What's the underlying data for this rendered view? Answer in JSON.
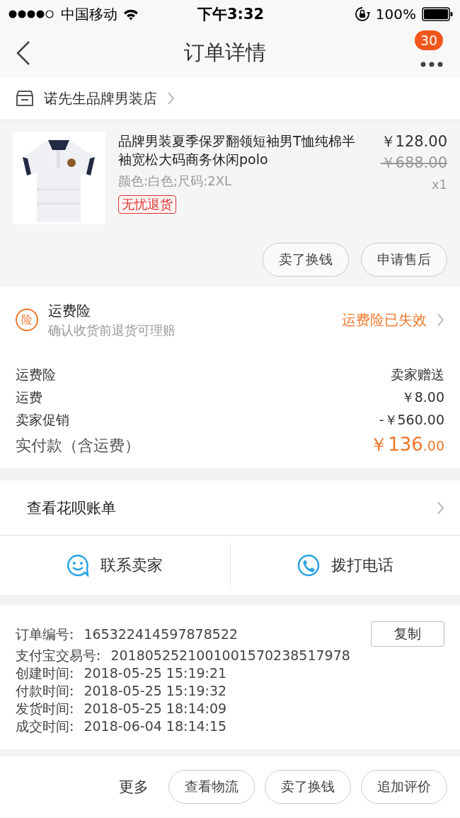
{
  "status_bar": {
    "carrier": "中国移动",
    "time": "下午3:32",
    "battery": "100%"
  },
  "nav": {
    "title": "订单详情",
    "badge": "30"
  },
  "store": {
    "name": "诺先生品牌男装店"
  },
  "product": {
    "title": "品牌男装夏季保罗翻领短袖男T恤纯棉半袖宽松大码商务休闲polo",
    "price": "￥128.00",
    "original_price": "￥688.00",
    "spec": "颜色:白色;尺码:2XL",
    "quantity": "x1",
    "tag": "无忧退货",
    "buttons": [
      "卖了换钱",
      "申请售后"
    ]
  },
  "insurance": {
    "icon_char": "险",
    "title": "运费险",
    "subtitle": "确认收货前退货可理赔",
    "status": "运费险已失效"
  },
  "fees": [
    {
      "label": "运费险",
      "value": "卖家赠送"
    },
    {
      "label": "运费",
      "value": "￥8.00"
    },
    {
      "label": "卖家促销",
      "value": "-￥560.00"
    }
  ],
  "total": {
    "label": "实付款（含运费）",
    "amount": "￥136",
    "decimals": ".00"
  },
  "huabei": {
    "label": "查看花呗账单"
  },
  "contact": [
    {
      "kind": "chat",
      "label": "联系卖家"
    },
    {
      "kind": "phone",
      "label": "拨打电话"
    }
  ],
  "order_info": {
    "rows": [
      {
        "label": "订单编号:",
        "value": "165322414597878522"
      },
      {
        "label": "支付宝交易号:",
        "value": "2018052521001001570238517978"
      },
      {
        "label": "创建时间:",
        "value": "2018-05-25 15:19:21"
      },
      {
        "label": "付款时间:",
        "value": "2018-05-25 15:19:32"
      },
      {
        "label": "发货时间:",
        "value": "2018-05-25 18:14:09"
      },
      {
        "label": "成交时间:",
        "value": "2018-06-04 18:14:15"
      }
    ],
    "copy_button": "复制"
  },
  "bottom_bar": {
    "more": "更多",
    "buttons": [
      "查看物流",
      "卖了换钱",
      "追加评价"
    ]
  }
}
